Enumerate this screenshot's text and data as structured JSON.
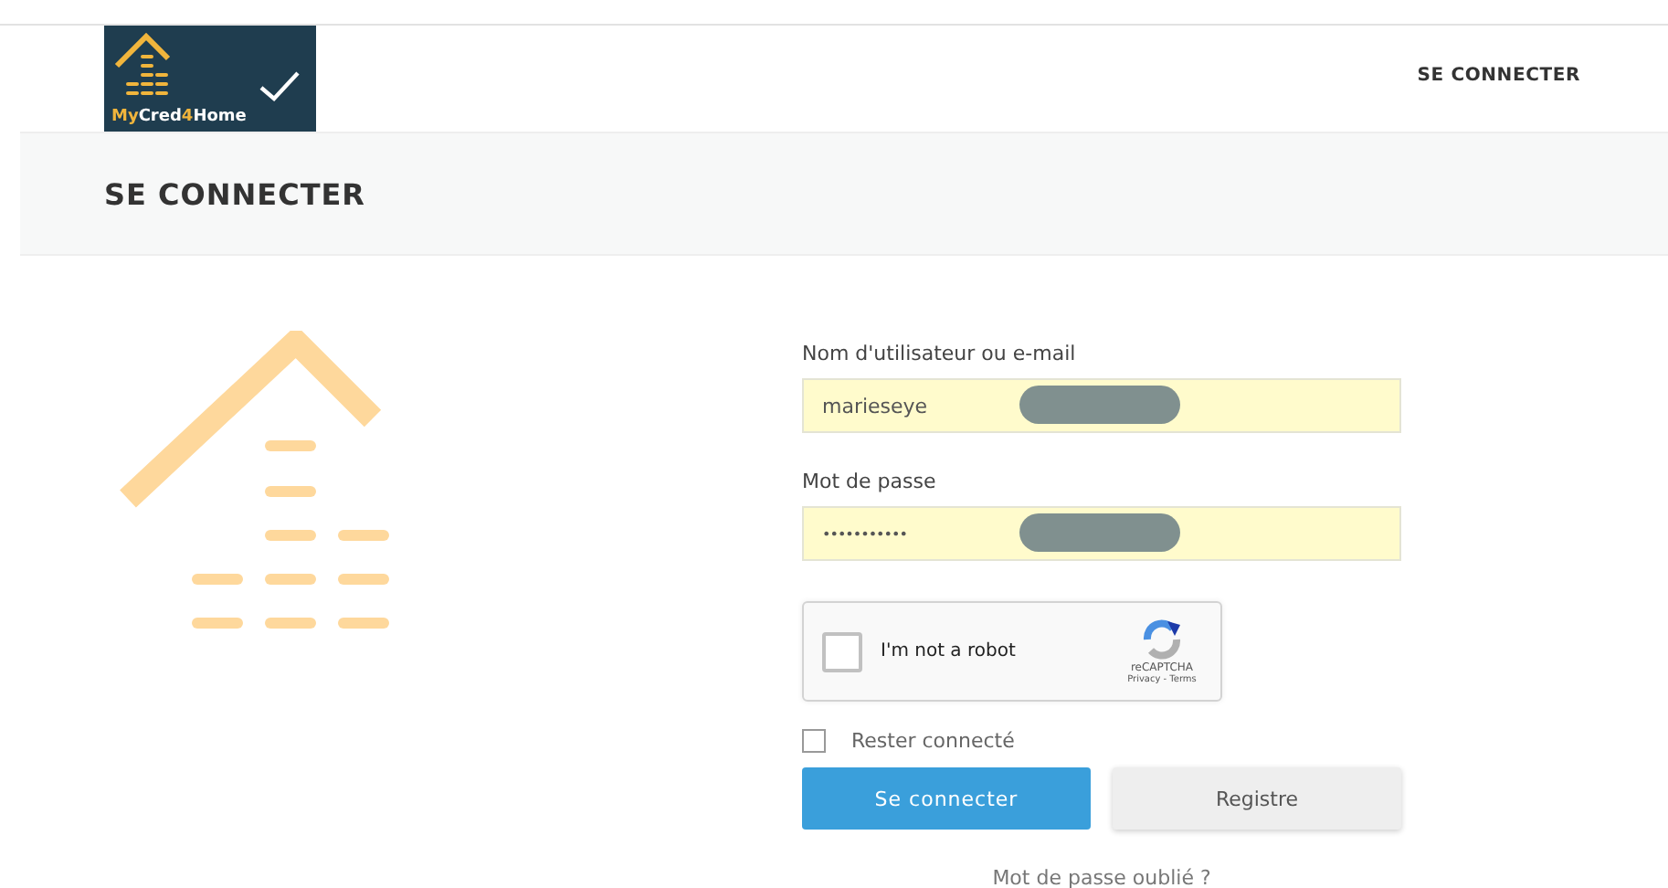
{
  "logo": {
    "text_parts": [
      {
        "text": "My",
        "accent": true
      },
      {
        "text": "Cred",
        "accent": false
      },
      {
        "text": "4",
        "accent": true
      },
      {
        "text": "Home",
        "accent": false
      }
    ]
  },
  "nav": {
    "link": "SE CONNECTER"
  },
  "page_title": "SE CONNECTER",
  "form": {
    "username": {
      "label": "Nom d'utilisateur ou e-mail",
      "value": "marieseye"
    },
    "password": {
      "label": "Mot de passe",
      "value": "•••••••••••"
    },
    "captcha": {
      "label": "I'm not a robot",
      "checked": false,
      "brand": "reCAPTCHA",
      "links": "Privacy - Terms"
    },
    "remember": {
      "label": "Rester connecté",
      "checked": false
    },
    "buttons": [
      {
        "label": "Se connecter",
        "kind": "primary"
      },
      {
        "label": "Registre",
        "kind": "secondary"
      }
    ],
    "forgot": "Mot de passe oublié ?"
  }
}
